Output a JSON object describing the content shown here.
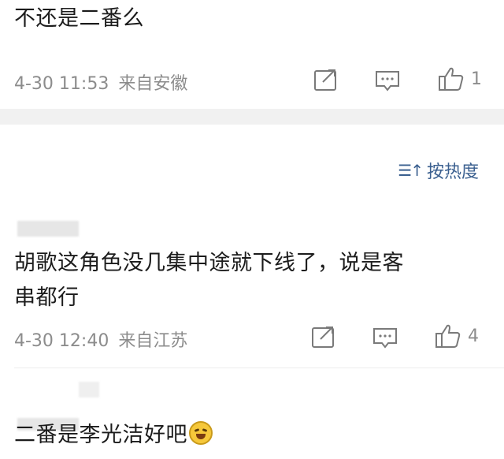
{
  "comments": [
    {
      "text": "不还是二番么",
      "date": "4-30 11:53",
      "location": "来自安徽",
      "likes": "1"
    },
    {
      "text_line1": "胡歌这角色没几集中途就下线了，说是客",
      "text_line2": "串都行",
      "date": "4-30 12:40",
      "location": "来自江苏",
      "likes": "4"
    },
    {
      "text": "二番是李光洁好吧"
    }
  ],
  "sort": {
    "icon": "sort-icon",
    "label": "按热度"
  },
  "icons": {
    "share": "share-icon",
    "comment": "comment-icon",
    "like": "thumbs-up-icon",
    "emoji": "laughing-crying-emoji-icon"
  },
  "colors": {
    "link": "#3a5f8f",
    "meta_gray": "#8c8c8c",
    "band": "#f1f1f1"
  }
}
